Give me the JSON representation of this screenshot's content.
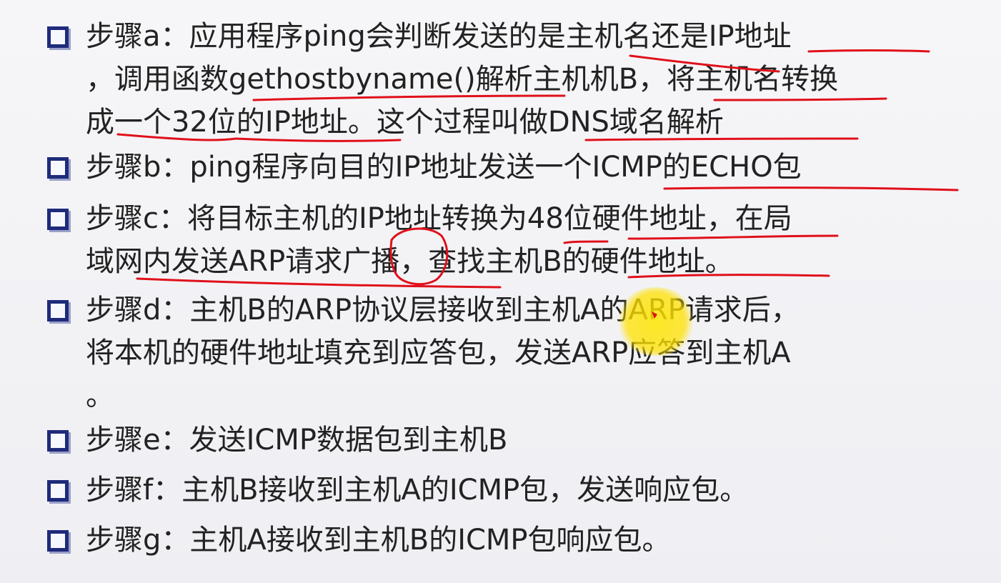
{
  "steps": [
    {
      "id": "a",
      "lines": [
        "步骤a：应用程序ping会判断发送的是主机名还是IP地址",
        "，调用函数gethostbyname()解析主机机B，将主机名转换",
        "成一个32位的IP地址。这个过程叫做DNS域名解析"
      ]
    },
    {
      "id": "b",
      "lines": [
        "步骤b：ping程序向目的IP地址发送一个ICMP的ECHO包"
      ]
    },
    {
      "id": "c",
      "lines": [
        "步骤c：将目标主机的IP地址转换为48位硬件地址，在局",
        "域网内发送ARP请求广播，查找主机B的硬件地址。"
      ]
    },
    {
      "id": "d",
      "lines": [
        "步骤d：主机B的ARP协议层接收到主机A的ARP请求后，",
        "将本机的硬件地址填充到应答包，发送ARP应答到主机A",
        "。"
      ]
    },
    {
      "id": "e",
      "lines": [
        "步骤e：发送ICMP数据包到主机B"
      ]
    },
    {
      "id": "f",
      "lines": [
        "步骤f：主机B接收到主机A的ICMP包，发送响应包。"
      ]
    },
    {
      "id": "g",
      "lines": [
        "步骤g：主机A接收到主机B的ICMP包响应包。"
      ]
    }
  ],
  "colors": {
    "bullet": "#1f2b7a",
    "annotation": "#e0101a",
    "highlight": "#ffe000",
    "text": "#222222"
  }
}
